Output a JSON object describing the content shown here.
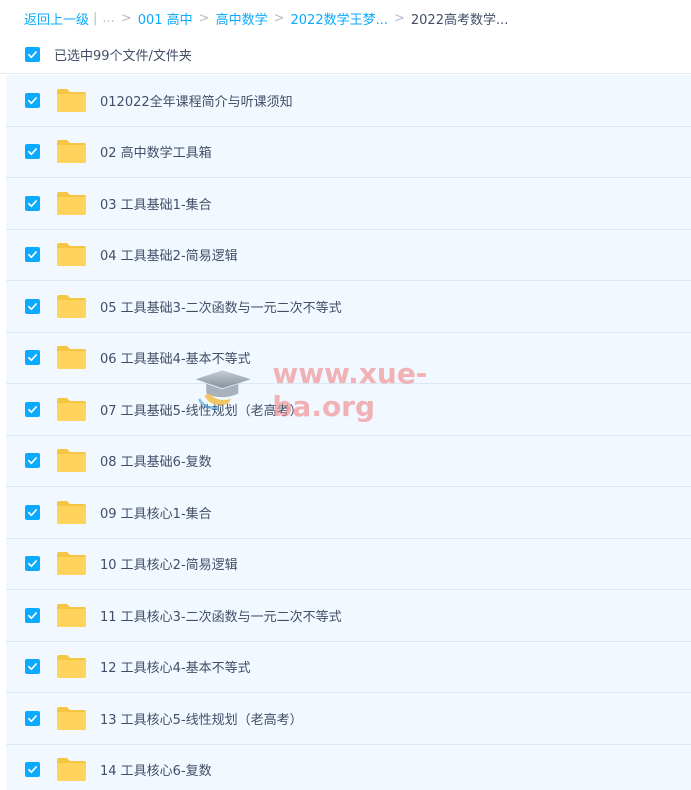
{
  "breadcrumb": {
    "back_label": "返回上一级",
    "pipe": "|",
    "ellipsis": "...",
    "separator": ">",
    "items": [
      "001 高中",
      "高中数学",
      "2022数学王梦..."
    ],
    "current": "2022高考数学..."
  },
  "selection": {
    "label": "已选中99个文件/文件夹"
  },
  "files": [
    {
      "name": "012022全年课程简介与听课须知"
    },
    {
      "name": "02 高中数学工具箱"
    },
    {
      "name": "03 工具基础1-集合"
    },
    {
      "name": "04 工具基础2-简易逻辑"
    },
    {
      "name": "05 工具基础3-二次函数与一元二次不等式"
    },
    {
      "name": "06 工具基础4-基本不等式"
    },
    {
      "name": "07 工具基础5-线性规划（老高考）"
    },
    {
      "name": "08 工具基础6-复数"
    },
    {
      "name": "09 工具核心1-集合"
    },
    {
      "name": "10 工具核心2-简易逻辑"
    },
    {
      "name": "11 工具核心3-二次函数与一元二次不等式"
    },
    {
      "name": "12 工具核心4-基本不等式"
    },
    {
      "name": "13 工具核心5-线性规划（老高考）"
    },
    {
      "name": "14 工具核心6-复数"
    }
  ],
  "watermark": {
    "text": "www.xue-ba.org"
  },
  "colors": {
    "accent": "#09aaff",
    "folder": "#ffd35c",
    "row_bg": "#f1f8ff",
    "text": "#424e67"
  },
  "icons": {
    "checkbox": "checkmark-icon",
    "folder": "folder-icon",
    "watermark": "graduation-cap-icon"
  }
}
